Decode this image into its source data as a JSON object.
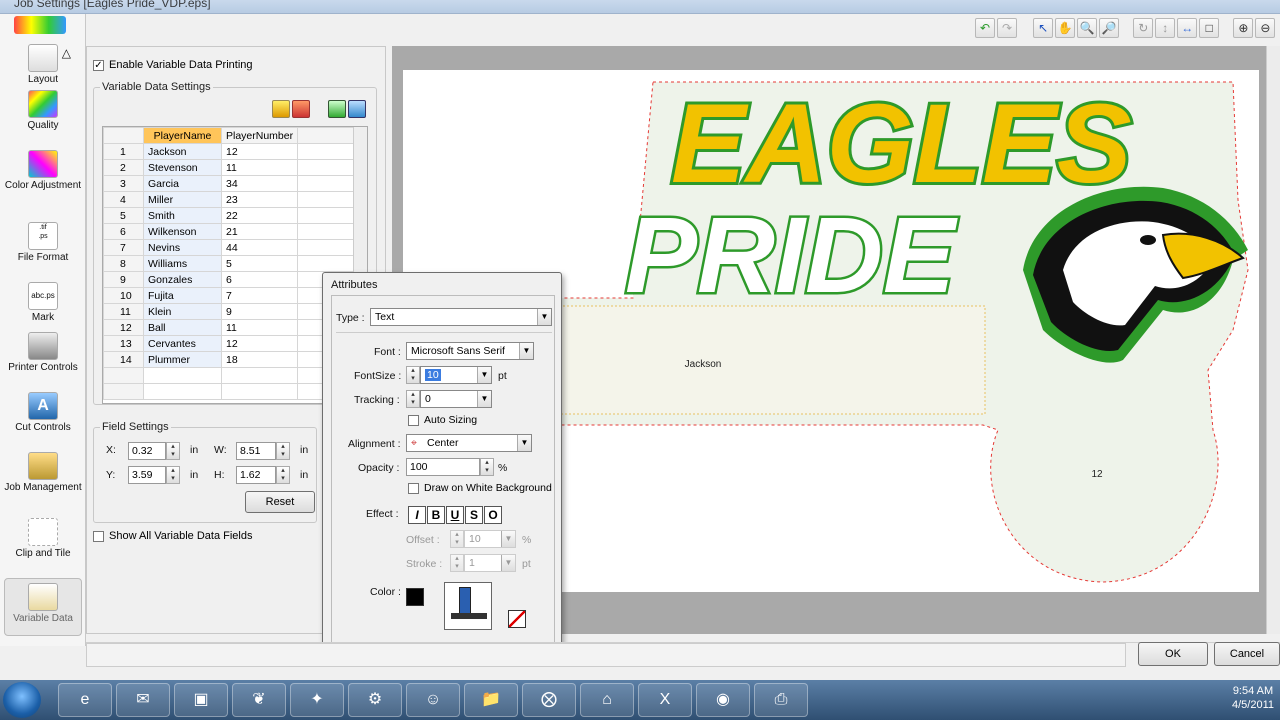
{
  "window": {
    "title": "Job Settings [Eagles Pride_VDP.eps]"
  },
  "sidebar": {
    "items": [
      {
        "label": "Layout",
        "icon": "layout-icon"
      },
      {
        "label": "Quality",
        "icon": "quality-icon"
      },
      {
        "label": "Color Adjustment",
        "icon": "color-adjustment-icon"
      },
      {
        "label": "File Format",
        "icon": "file-format-icon"
      },
      {
        "label": "Mark",
        "icon": "mark-icon"
      },
      {
        "label": "Printer Controls",
        "icon": "printer-icon"
      },
      {
        "label": "Cut Controls",
        "icon": "cut-icon"
      },
      {
        "label": "Job Management",
        "icon": "job-management-icon"
      },
      {
        "label": "Clip and Tile",
        "icon": "clip-tile-icon"
      },
      {
        "label": "Variable Data",
        "icon": "variable-data-icon"
      }
    ]
  },
  "vdp": {
    "enable_label": "Enable Variable Data Printing",
    "enable_checked": true,
    "group_label": "Variable Data Settings",
    "columns": [
      "PlayerName",
      "PlayerNumber"
    ],
    "rows": [
      {
        "n": "1",
        "name": "Jackson",
        "num": "12"
      },
      {
        "n": "2",
        "name": "Stevenson",
        "num": "11"
      },
      {
        "n": "3",
        "name": "Garcia",
        "num": "34"
      },
      {
        "n": "4",
        "name": "Miller",
        "num": "23"
      },
      {
        "n": "5",
        "name": "Smith",
        "num": "22"
      },
      {
        "n": "6",
        "name": "Wilkenson",
        "num": "21"
      },
      {
        "n": "7",
        "name": "Nevins",
        "num": "44"
      },
      {
        "n": "8",
        "name": "Williams",
        "num": "5"
      },
      {
        "n": "9",
        "name": "Gonzales",
        "num": "6"
      },
      {
        "n": "10",
        "name": "Fujita",
        "num": "7"
      },
      {
        "n": "11",
        "name": "Klein",
        "num": "9"
      },
      {
        "n": "12",
        "name": "Ball",
        "num": "11"
      },
      {
        "n": "13",
        "name": "Cervantes",
        "num": "12"
      },
      {
        "n": "14",
        "name": "Plummer",
        "num": "18"
      }
    ],
    "field_settings": {
      "label": "Field Settings",
      "x_label": "X:",
      "x": "0.32",
      "y_label": "Y:",
      "y": "3.59",
      "w_label": "W:",
      "w": "8.51",
      "h_label": "H:",
      "h": "1.62",
      "unit": "in",
      "reset": "Reset"
    },
    "show_all_label": "Show All Variable Data Fields"
  },
  "attributes": {
    "title": "Attributes",
    "type_label": "Type :",
    "type": "Text",
    "font_label": "Font :",
    "font": "Microsoft Sans Serif",
    "fontsize_label": "FontSize :",
    "fontsize": "10",
    "fontsize_unit": "pt",
    "tracking_label": "Tracking :",
    "tracking": "0",
    "auto_sizing": "Auto Sizing",
    "alignment_label": "Alignment :",
    "alignment": "Center",
    "opacity_label": "Opacity :",
    "opacity": "100",
    "opacity_unit": "%",
    "draw_white": "Draw on White Background",
    "effect_label": "Effect :",
    "effects": [
      "I",
      "B",
      "U",
      "S",
      "O"
    ],
    "offset_label": "Offset :",
    "offset": "10",
    "offset_unit": "%",
    "stroke_label": "Stroke :",
    "stroke": "1",
    "stroke_unit": "pt",
    "color_label": "Color :",
    "text_color": "#000000"
  },
  "preview": {
    "logo_line1": "EAGLES",
    "logo_line2": "PRIDE",
    "name_field": "Jackson",
    "number_field": "12",
    "colors": {
      "yellow": "#f2c200",
      "green": "#2e9a2a"
    }
  },
  "buttons": {
    "ok": "OK",
    "cancel": "Cancel"
  },
  "taskbar": {
    "time": "9:54 AM",
    "date": "4/5/2011"
  }
}
